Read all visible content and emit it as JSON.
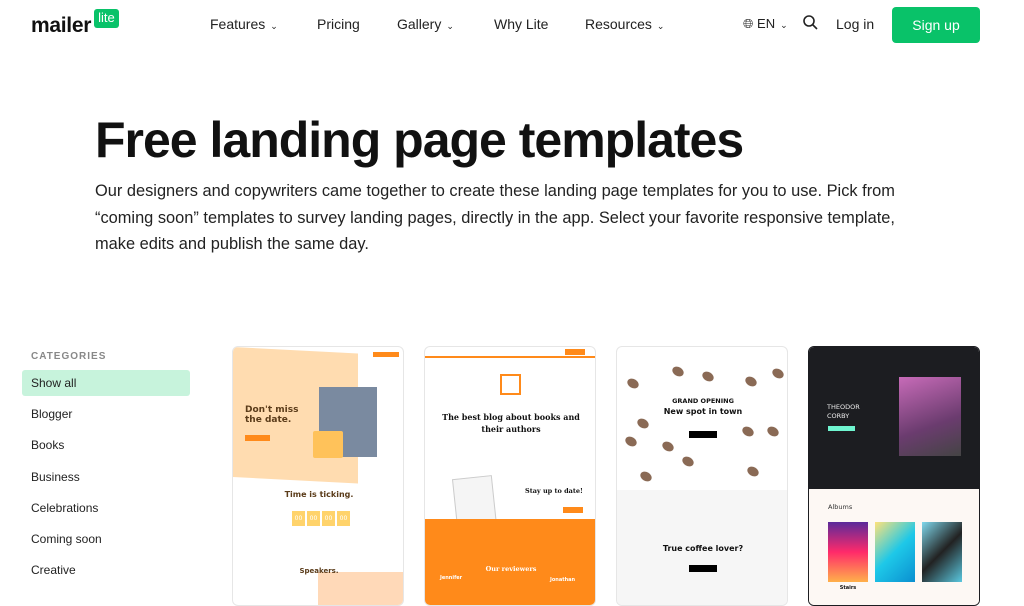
{
  "nav": {
    "logo_main": "mailer",
    "logo_badge": "lite",
    "items": [
      {
        "label": "Features",
        "dropdown": true
      },
      {
        "label": "Pricing",
        "dropdown": false
      },
      {
        "label": "Gallery",
        "dropdown": true
      },
      {
        "label": "Why Lite",
        "dropdown": false
      },
      {
        "label": "Resources",
        "dropdown": true
      }
    ],
    "language": "EN",
    "login": "Log in",
    "signup": "Sign up"
  },
  "hero": {
    "title": "Free landing page templates",
    "description": "Our designers and copywriters came together to create these landing page templates for you to use. Pick from “coming soon” templates to survey landing pages, directly in the app. Select your favorite responsive template, make edits and publish the same day."
  },
  "sidebar": {
    "heading": "CATEGORIES",
    "items": [
      "Show all",
      "Blogger",
      "Books",
      "Business",
      "Celebrations",
      "Coming soon",
      "Creative"
    ],
    "active": "Show all"
  },
  "templates": [
    {
      "headline": "Don't miss the date.",
      "sub": "Time is ticking.",
      "countdown": [
        "00",
        "00",
        "00",
        "00"
      ],
      "section": "Speakers."
    },
    {
      "headline": "The best blog about books and their authors",
      "sub": "Stay up to date!",
      "section": "Our reviewers",
      "people": [
        "Jennifer",
        "Jonathan"
      ]
    },
    {
      "kicker": "GRAND OPENING",
      "headline": "New spot in town",
      "sub": "True coffee lover?"
    },
    {
      "name": "THEODOR CORBY",
      "section": "Albums",
      "albums": [
        "Stairs"
      ]
    }
  ],
  "colors": {
    "brand": "#09c269",
    "active_bg": "#c7f3dc",
    "orange": "#ff8a1a",
    "dark": "#1c1d21"
  }
}
